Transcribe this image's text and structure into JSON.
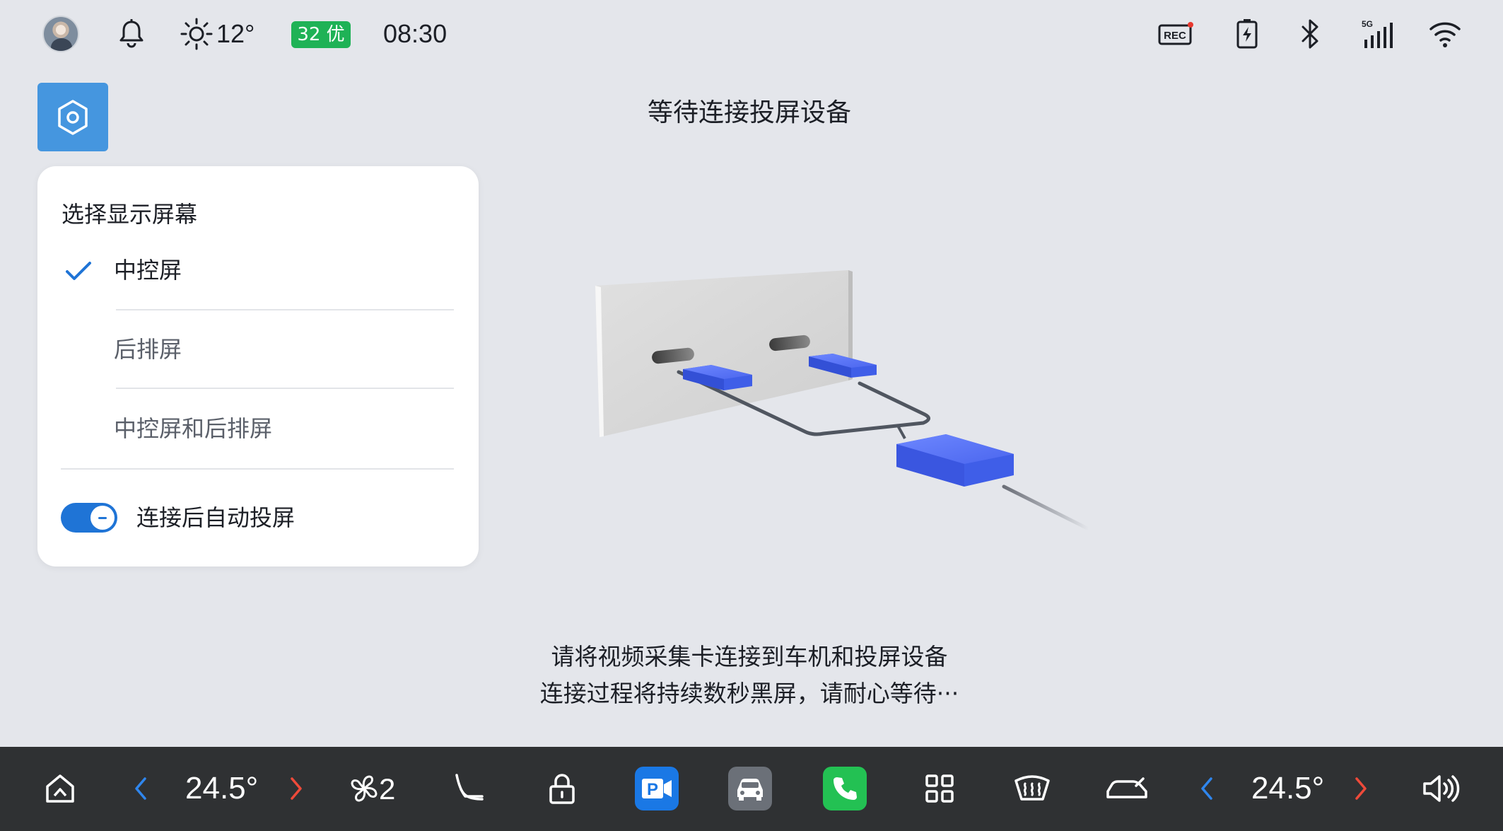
{
  "status_bar": {
    "weather_temp": "12°",
    "air_quality": "32 优",
    "time": "08:30",
    "icons": [
      "avatar",
      "bell-icon",
      "sun-icon",
      "rec-icon",
      "charging-icon",
      "bluetooth-icon",
      "signal-5g-icon",
      "wifi-icon"
    ],
    "rec_label": "REC",
    "net_label": "5G"
  },
  "page": {
    "title": "等待连接投屏设备",
    "instructions": [
      "请将视频采集卡连接到车机和投屏设备",
      "连接过程将持续数秒黑屏，请耐心等待···"
    ]
  },
  "display_panel": {
    "title": "选择显示屏幕",
    "options": [
      {
        "label": "中控屏",
        "selected": true
      },
      {
        "label": "后排屏",
        "selected": false
      },
      {
        "label": "中控屏和后排屏",
        "selected": false
      }
    ],
    "auto_cast": {
      "label": "连接后自动投屏",
      "enabled": true
    }
  },
  "dock": {
    "left_temp": "24.5°",
    "right_temp": "24.5°",
    "fan_level": "2",
    "items": [
      "home-icon",
      "temp-decrease-left",
      "temp-increase-left",
      "fan-icon",
      "seat-icon",
      "lock-icon",
      "screen-cast-app",
      "car-app",
      "phone-app",
      "apps-grid-icon",
      "defrost-icon",
      "car-outline-icon",
      "temp-decrease-right",
      "temp-increase-right",
      "volume-icon"
    ]
  },
  "colors": {
    "background": "#e4e6eb",
    "accent": "#1f74d6",
    "settings_button": "#4596df",
    "aq_badge": "#1fb256",
    "dock": "#2f3133",
    "temp_down_arrow": "#2f86ee",
    "temp_up_arrow": "#ee4a3a",
    "phone_app": "#23c153",
    "cast_app": "#1a78e5",
    "car_app": "#6b7078"
  }
}
